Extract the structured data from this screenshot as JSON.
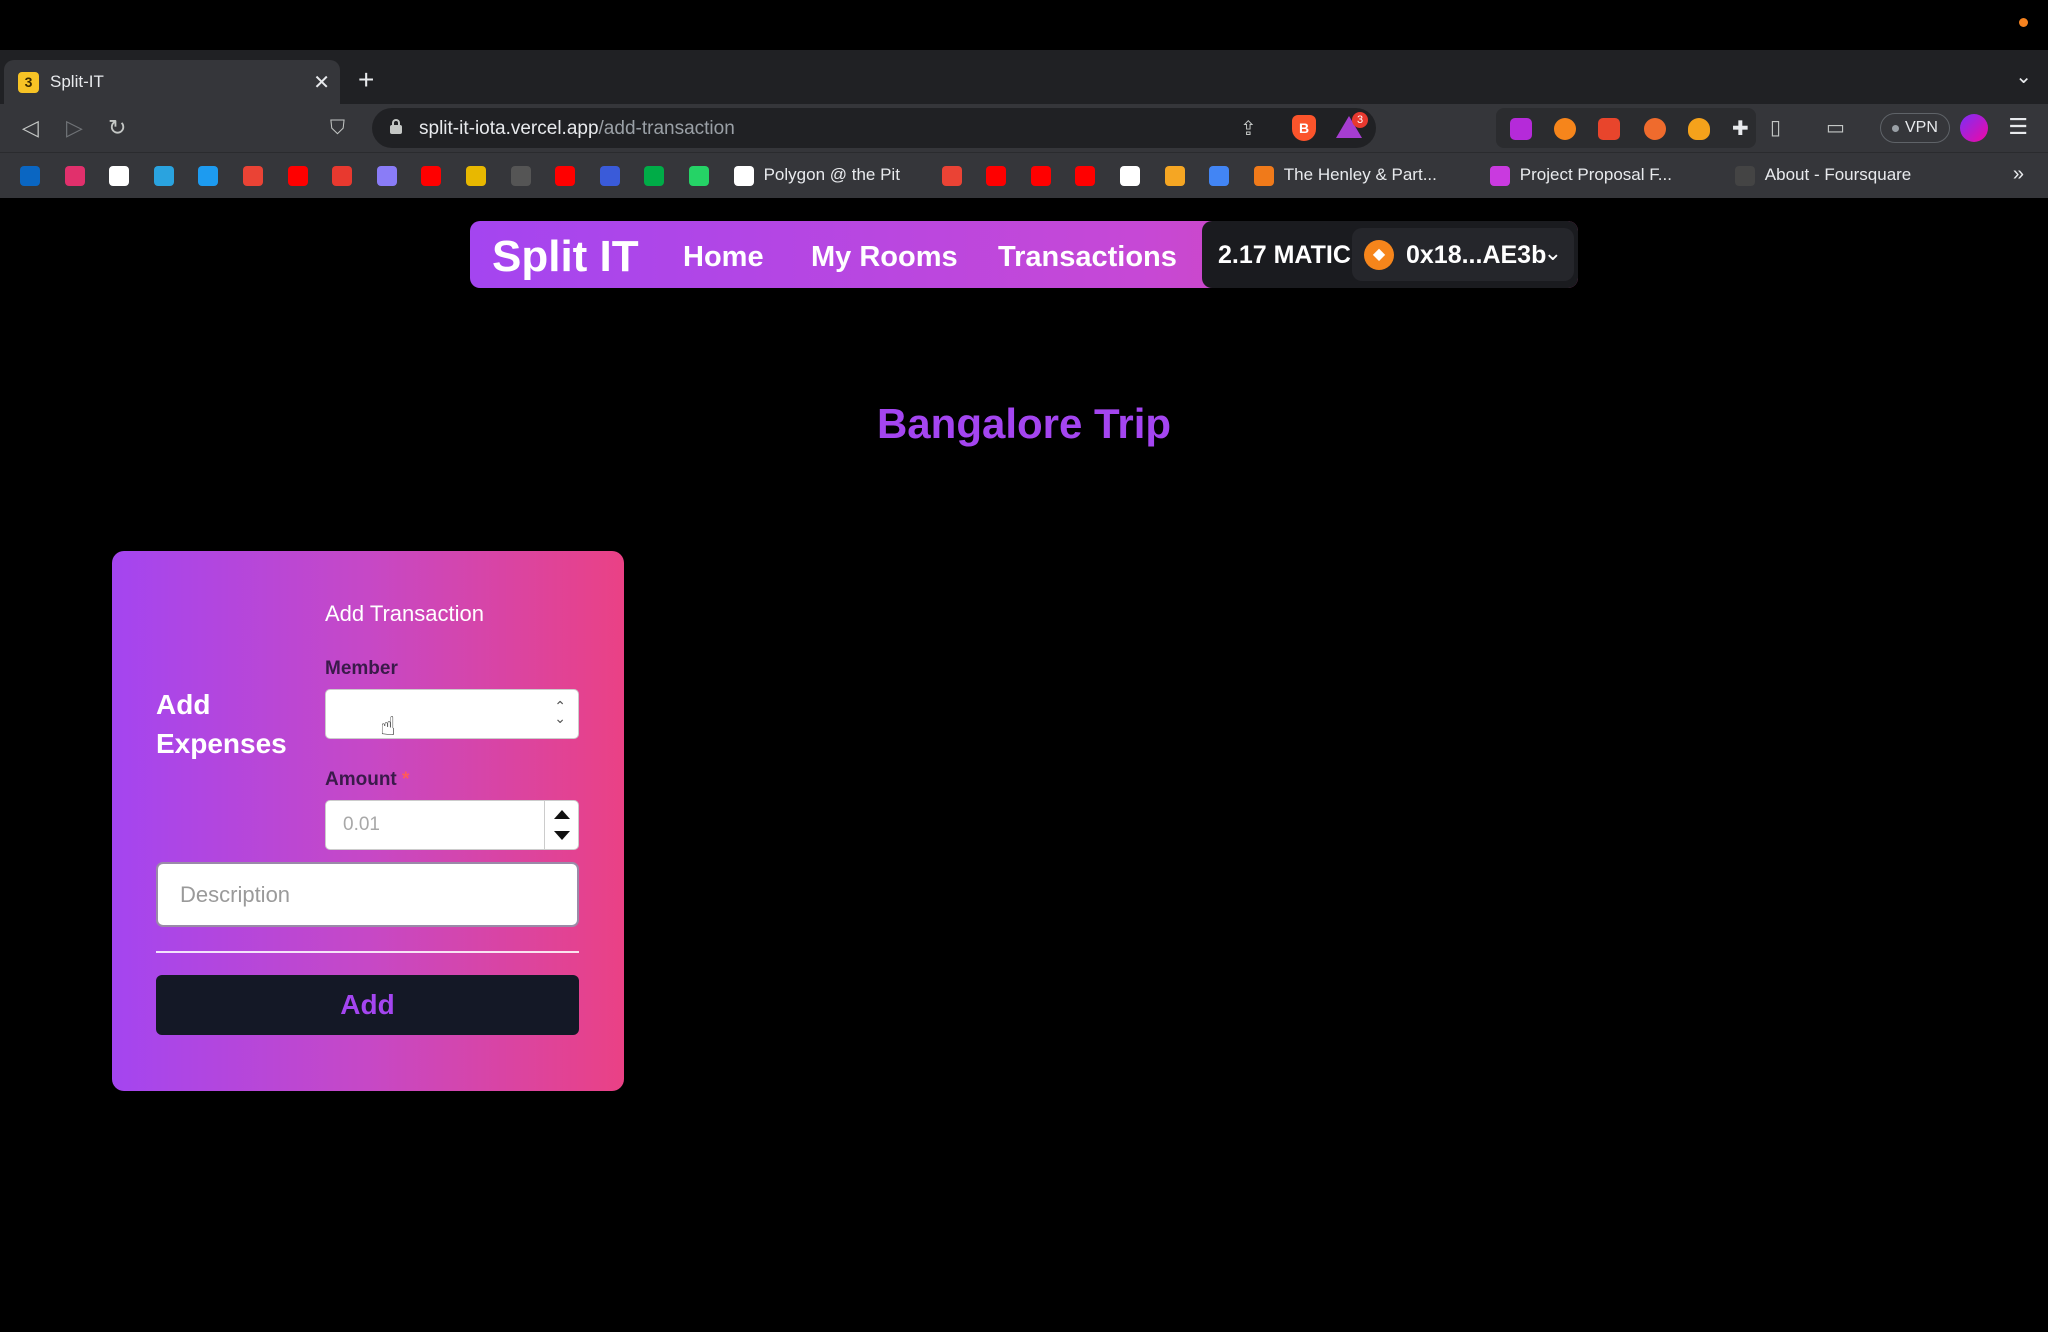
{
  "browser": {
    "tab": {
      "favicon": "3",
      "title": "Split-IT"
    },
    "url": {
      "host": "split-it-iota.vercel.app",
      "path": "/add-transaction"
    },
    "rewards_badge": "3",
    "vpn_label": "VPN",
    "bookmarks": [
      {
        "name": "linkedin",
        "label": "",
        "color": "#0a66c2"
      },
      {
        "name": "instagram",
        "label": "",
        "color": "#e1306c"
      },
      {
        "name": "github",
        "label": "",
        "color": "#ffffff"
      },
      {
        "name": "telegram",
        "label": "",
        "color": "#2aa3df"
      },
      {
        "name": "twitter",
        "label": "",
        "color": "#1d9bf0"
      },
      {
        "name": "gmail",
        "label": "",
        "color": "#ea4335"
      },
      {
        "name": "youtube",
        "label": "",
        "color": "#ff0000"
      },
      {
        "name": "opera",
        "label": "",
        "color": "#e8392f"
      },
      {
        "name": "link",
        "label": "",
        "color": "#8a7cf7"
      },
      {
        "name": "youtube",
        "label": "",
        "color": "#ff0000"
      },
      {
        "name": "bookmark-e",
        "label": "",
        "color": "#e8b800"
      },
      {
        "name": "bookmark-dark",
        "label": "",
        "color": "#555555"
      },
      {
        "name": "youtube",
        "label": "",
        "color": "#ff0000"
      },
      {
        "name": "bookmark-b",
        "label": "",
        "color": "#3a5bd9"
      },
      {
        "name": "meet",
        "label": "",
        "color": "#00ac47"
      },
      {
        "name": "whatsapp",
        "label": "",
        "color": "#25d366"
      },
      {
        "name": "notion",
        "label": "Polygon @ the Pit",
        "color": "#ffffff"
      },
      {
        "name": "gmail",
        "label": "",
        "color": "#ea4335"
      },
      {
        "name": "youtube",
        "label": "",
        "color": "#ff0000"
      },
      {
        "name": "youtube",
        "label": "",
        "color": "#ff0000"
      },
      {
        "name": "youtube",
        "label": "",
        "color": "#ff0000"
      },
      {
        "name": "medium",
        "label": "",
        "color": "#ffffff"
      },
      {
        "name": "bookmark-f",
        "label": "",
        "color": "#f5a623"
      },
      {
        "name": "chrome",
        "label": "",
        "color": "#4285f4"
      },
      {
        "name": "henley",
        "label": "The Henley & Part...",
        "color": "#f07a1a"
      },
      {
        "name": "proposal",
        "label": "Project Proposal F...",
        "color": "#c93adf"
      },
      {
        "name": "foursquare",
        "label": "About - Foursquare",
        "color": "#444444"
      }
    ],
    "bookmarks_overflow": "»"
  },
  "navbar": {
    "brand": "Split IT",
    "links": [
      "Home",
      "My Rooms",
      "Transactions"
    ],
    "balance": "2.17 MATIC",
    "address": "0x18...AE3b"
  },
  "room": {
    "title": "Bangalore Trip"
  },
  "form": {
    "heading": "Add Expenses",
    "title": "Add Transaction",
    "member_label": "Member",
    "member_value": "",
    "amount_label": "Amount",
    "amount_required": "*",
    "amount_placeholder": "0.01",
    "description_placeholder": "Description",
    "submit_label": "Add"
  },
  "colors": {
    "accent": "#a445f0",
    "gradient_end": "#ea4185",
    "button_bg": "#141826"
  }
}
